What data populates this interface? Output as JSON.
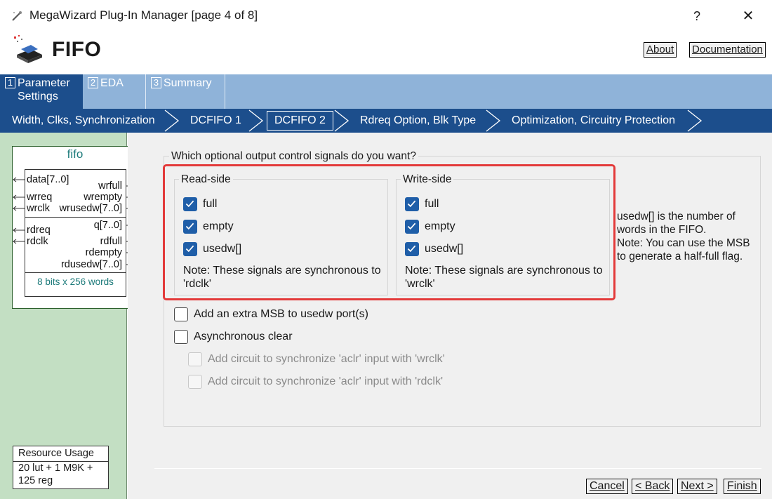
{
  "window": {
    "title": "MegaWizard Plug-In Manager [page 4 of 8]",
    "help_label": "?",
    "close_label": "✕"
  },
  "header": {
    "title": "FIFO",
    "about_label": "About",
    "documentation_label": "Documentation"
  },
  "steps": [
    {
      "num": "1",
      "label_line1": "Parameter",
      "label_line2": "Settings",
      "active": true
    },
    {
      "num": "2",
      "label_line1": "EDA",
      "label_line2": "",
      "active": false
    },
    {
      "num": "3",
      "label_line1": "Summary",
      "label_line2": "",
      "active": false
    }
  ],
  "pagenav": [
    {
      "label": "Width, Clks, Synchronization",
      "current": false
    },
    {
      "label": "DCFIFO 1",
      "current": false
    },
    {
      "label": "DCFIFO 2",
      "current": true
    },
    {
      "label": "Rdreq Option, Blk Type",
      "current": false
    },
    {
      "label": "Optimization, Circuitry Protection",
      "current": false
    }
  ],
  "symbol": {
    "title": "fifo",
    "ports_left": [
      "data[7..0]",
      "wrreq",
      "wrclk",
      "rdreq",
      "rdclk"
    ],
    "ports_right": [
      "wrfull",
      "wrempty",
      "wrusedw[7..0]",
      "q[7..0]",
      "rdfull",
      "rdempty",
      "rdusedw[7..0]"
    ],
    "info": "8 bits x 256 words"
  },
  "resource": {
    "title": "Resource Usage",
    "line1": "20 lut + 1 M9K +",
    "line2": "125 reg"
  },
  "main": {
    "question": "Which optional output control signals do you want?",
    "read_side": {
      "title": "Read-side",
      "options": [
        {
          "label": "full",
          "checked": true
        },
        {
          "label": "empty",
          "checked": true
        },
        {
          "label": "usedw[]",
          "checked": true
        }
      ],
      "note_line1": "Note: These signals are synchronous to",
      "note_line2": "'rdclk'"
    },
    "write_side": {
      "title": "Write-side",
      "options": [
        {
          "label": "full",
          "checked": true
        },
        {
          "label": "empty",
          "checked": true
        },
        {
          "label": "usedw[]",
          "checked": true
        }
      ],
      "note_line1": "Note: These signals are synchronous to",
      "note_line2": "'wrclk'"
    },
    "side_note": [
      "usedw[] is the number of",
      "words in the FIFO.",
      "Note: You can use the MSB",
      "to generate a half-full flag."
    ],
    "extra_msb": {
      "label": "Add an extra MSB to usedw port(s)",
      "checked": false
    },
    "async_clear": {
      "label": "Asynchronous clear",
      "checked": false
    },
    "sync_wrclk": {
      "label": "Add circuit to synchronize 'aclr' input with 'wrclk'",
      "checked": false,
      "enabled": false
    },
    "sync_rdclk": {
      "label": "Add circuit to synchronize 'aclr' input with 'rdclk'",
      "checked": false,
      "enabled": false
    }
  },
  "footer": {
    "cancel_label": "Cancel",
    "back_label": "< Back",
    "next_label": "Next >",
    "finish_label": "Finish"
  },
  "colors": {
    "nav_dark": "#1c4e8c",
    "nav_light": "#8fb3d9",
    "left_panel": "#c3dfc3",
    "checkbox_checked": "#1f5ea8",
    "highlight": "#e33a3a"
  }
}
